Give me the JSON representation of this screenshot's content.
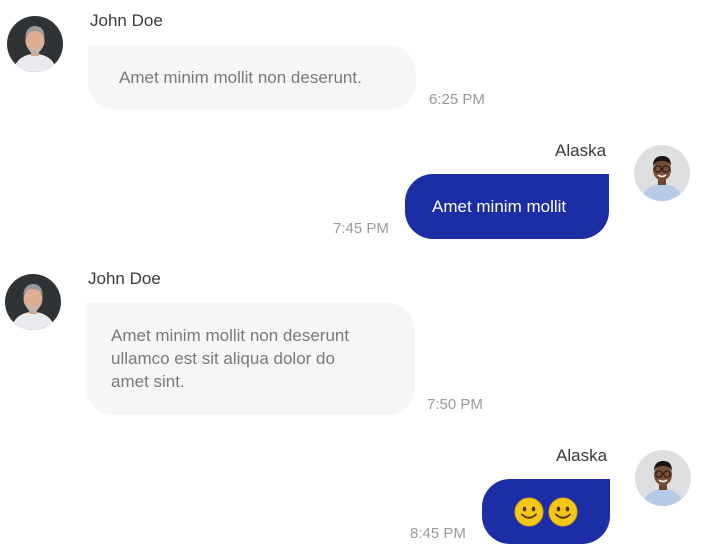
{
  "messages": [
    {
      "sender": "John Doe",
      "text": "Amet minim mollit non deserunt.",
      "time": "6:25 PM",
      "direction": "incoming",
      "avatar": "john-doe-avatar"
    },
    {
      "sender": "Alaska",
      "text": "Amet minim mollit",
      "time": "7:45 PM",
      "direction": "outgoing",
      "avatar": "alaska-avatar"
    },
    {
      "sender": "John Doe",
      "lines": [
        "Amet minim mollit non deserunt",
        "ullamco est sit aliqua dolor do",
        "amet sint."
      ],
      "time": "7:50 PM",
      "direction": "incoming",
      "avatar": "john-doe-avatar"
    },
    {
      "sender": "Alaska",
      "emojis": [
        "smiley-face-icon",
        "smiley-face-icon"
      ],
      "time": "8:45 PM",
      "direction": "outgoing",
      "avatar": "alaska-avatar"
    }
  ],
  "colors": {
    "incoming_bubble": "#f6f6f6",
    "outgoing_bubble": "#1c2ea5",
    "timestamp": "#9a9a9a",
    "emoji": "#f5c518"
  }
}
